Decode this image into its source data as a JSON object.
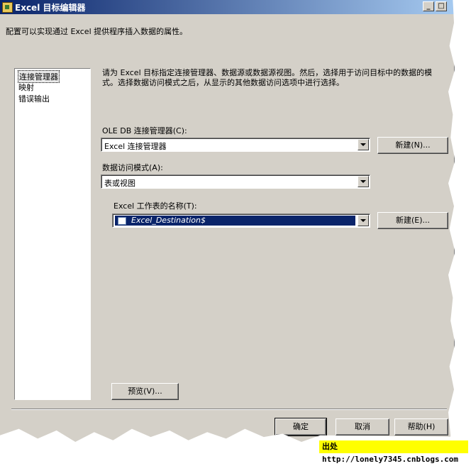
{
  "window": {
    "title": "Excel 目标编辑器"
  },
  "description": "配置可以实现通过 Excel 提供程序插入数据的属性。",
  "nav": {
    "items": [
      {
        "label": "连接管理器",
        "selected": true
      },
      {
        "label": "映射",
        "selected": false
      },
      {
        "label": "错误输出",
        "selected": false
      }
    ]
  },
  "main": {
    "instructions": "请为 Excel 目标指定连接管理器、数据源或数据源视图。然后，选择用于访问目标中的数据的模式。选择数据访问模式之后，从显示的其他数据访问选项中进行选择。",
    "connection_label": "OLE DB 连接管理器(C):",
    "connection_value": "Excel 连接管理器",
    "connection_new_button": "新建(N)...",
    "access_mode_label": "数据访问模式(A):",
    "access_mode_value": "表或视图",
    "sheet_label": "Excel 工作表的名称(T):",
    "sheet_value": "Excel_Destination$",
    "sheet_new_button": "新建(E)...",
    "preview_button": "预览(V)..."
  },
  "footer": {
    "ok_button": "确定",
    "cancel_button": "取消",
    "help_button": "帮助(H)"
  },
  "watermark": "出处http://lonely7345.cnblogs.com"
}
